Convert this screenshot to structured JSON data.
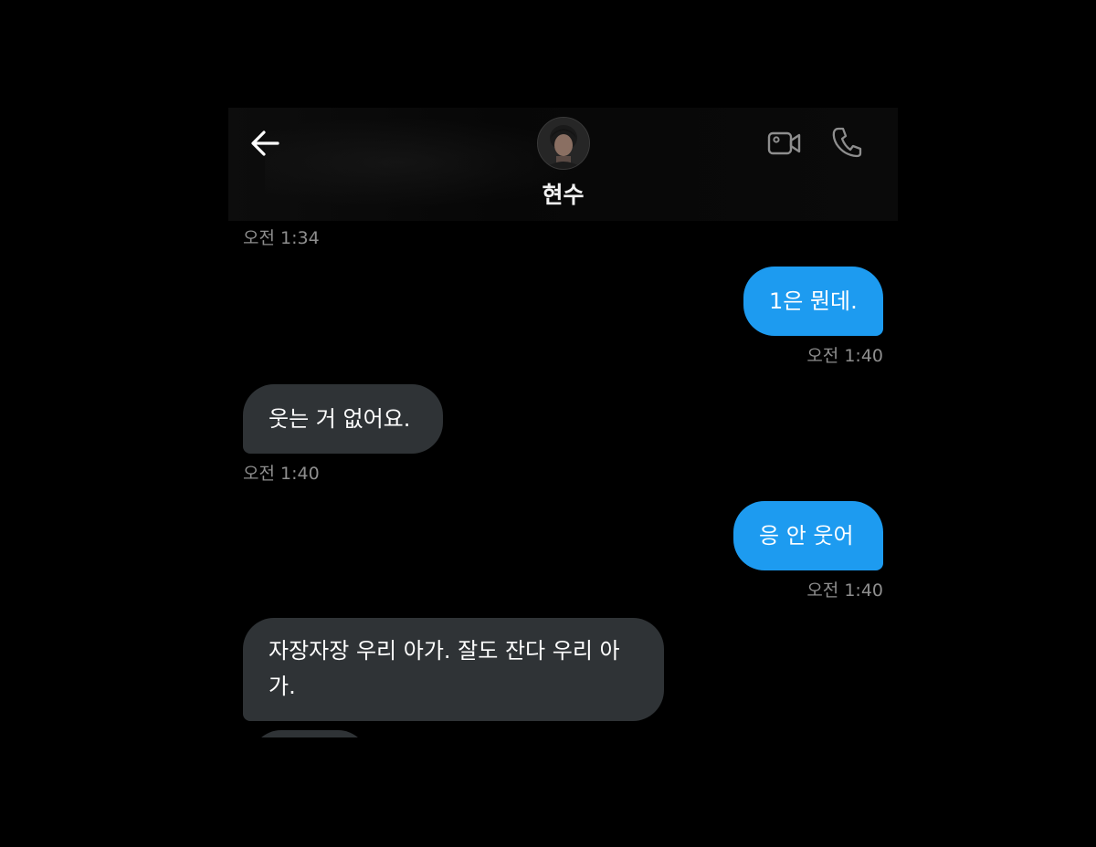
{
  "header": {
    "contact_name": "현수",
    "back_icon": "arrow-left-icon",
    "video_icon": "video-camera-icon",
    "call_icon": "phone-icon",
    "avatar_icon": "avatar"
  },
  "colors": {
    "background": "#000000",
    "outgoing_bubble": "#1d9bf0",
    "incoming_bubble": "#2f3336",
    "timestamp": "#8e8e8e"
  },
  "messages": [
    {
      "direction": "timestamp-only",
      "time": "오전 1:34"
    },
    {
      "direction": "outgoing",
      "text": "1은 뭔데.",
      "time": "오전 1:40"
    },
    {
      "direction": "incoming",
      "text": "웃는 거 없어요.",
      "time": "오전 1:40"
    },
    {
      "direction": "outgoing",
      "text": "응 안 웃어",
      "time": "오전 1:40"
    },
    {
      "direction": "incoming",
      "text_line1": "자장자장 우리 아가. 잘도 잔다 우리 아",
      "text_line2": "가.",
      "time": ""
    }
  ]
}
